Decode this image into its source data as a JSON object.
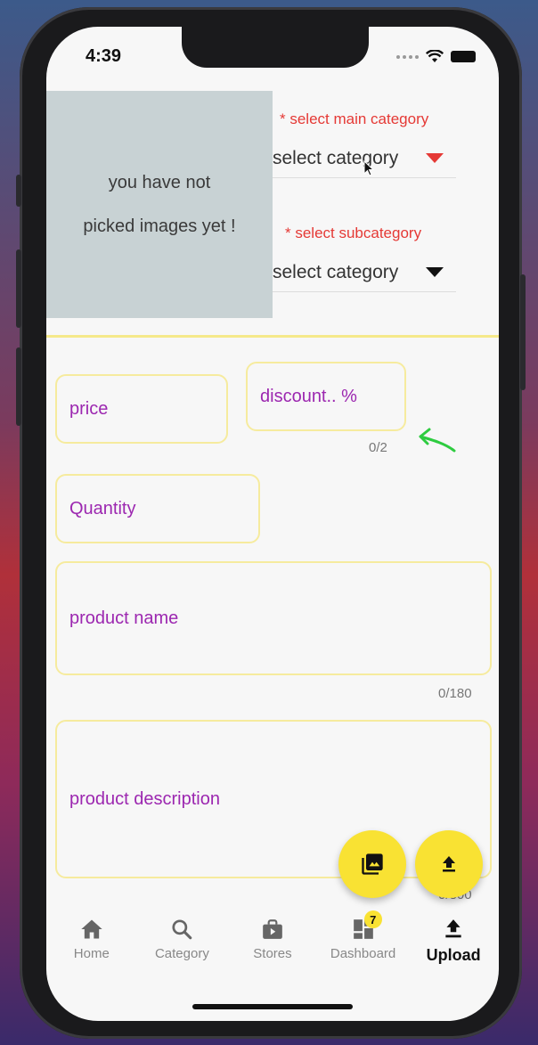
{
  "status": {
    "time": "4:39"
  },
  "image_placeholder": {
    "line1": "you have not",
    "line2": "picked images yet !"
  },
  "main_category": {
    "label": "* select main category",
    "value": "select category",
    "arrow_color": "#e53935"
  },
  "sub_category": {
    "label": "* select subcategory",
    "value": "select category",
    "arrow_color": "#111111"
  },
  "fields": {
    "price": {
      "placeholder": "price"
    },
    "discount": {
      "placeholder": "discount.. %",
      "counter": "0/2"
    },
    "quantity": {
      "placeholder": "Quantity"
    },
    "product_name": {
      "placeholder": "product name",
      "counter": "0/180"
    },
    "product_description": {
      "placeholder": "product description",
      "counter": "0/800"
    }
  },
  "nav": {
    "items": [
      {
        "label": "Home",
        "icon": "home-icon"
      },
      {
        "label": "Category",
        "icon": "search-icon"
      },
      {
        "label": "Stores",
        "icon": "shop-icon"
      },
      {
        "label": "Dashboard",
        "icon": "dashboard-icon",
        "badge": "7"
      },
      {
        "label": "Upload",
        "icon": "upload-icon",
        "active": true
      }
    ]
  },
  "colors": {
    "accent_yellow": "#f9e233",
    "field_border": "#f6eb9e",
    "hint_purple": "#9c27b0",
    "category_red": "#e53935"
  }
}
